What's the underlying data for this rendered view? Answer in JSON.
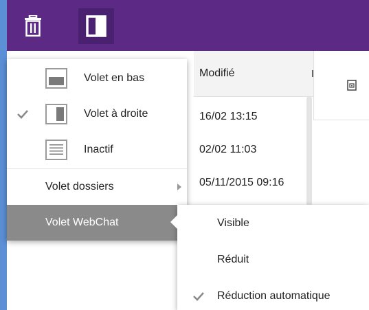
{
  "toolbar": {
    "delete_icon": "trash-icon",
    "pane_icon": "layout-pane-icon",
    "bg_color": "#5c2a84",
    "active_bg_color": "#4a2070"
  },
  "table": {
    "column_header": "Modifié",
    "rows": [
      "16/02 13:15",
      "02/02 11:03",
      "05/11/2015 09:16"
    ]
  },
  "right_panel": {
    "icon": "document-icon"
  },
  "menu": {
    "items": [
      {
        "label": "Volet en bas",
        "icon": "pane-bottom-icon",
        "checked": false
      },
      {
        "label": "Volet à droite",
        "icon": "pane-right-icon",
        "checked": true
      },
      {
        "label": "Inactif",
        "icon": "pane-off-icon",
        "checked": false
      }
    ],
    "folders": {
      "label": "Volet dossiers",
      "has_submenu": true
    },
    "webchat": {
      "label": "Volet WebChat",
      "has_submenu": true,
      "highlighted": true
    },
    "highlight_color": "#8a8a8a"
  },
  "submenu": {
    "items": [
      {
        "label": "Visible",
        "checked": false
      },
      {
        "label": "Réduit",
        "checked": false
      },
      {
        "label": "Réduction automatique",
        "checked": true
      }
    ]
  }
}
